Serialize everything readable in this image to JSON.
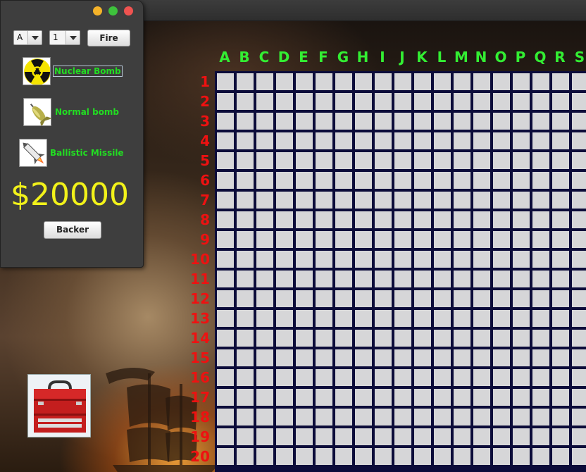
{
  "sidebar": {
    "column_select": {
      "value": "A"
    },
    "row_select": {
      "value": "1"
    },
    "fire_label": "Fire",
    "weapons": [
      {
        "label": "Nuclear Bomb",
        "icon": "radiation-icon"
      },
      {
        "label": "Normal bomb",
        "icon": "bomb-icon"
      },
      {
        "label": "Ballistic Missile",
        "icon": "missile-icon"
      }
    ],
    "money": "$20000",
    "backer_label": "Backer"
  },
  "grid": {
    "columns": [
      "A",
      "B",
      "C",
      "D",
      "E",
      "F",
      "G",
      "H",
      "I",
      "J",
      "K",
      "L",
      "M",
      "N",
      "O",
      "P",
      "Q",
      "R",
      "S"
    ],
    "rows": [
      "1",
      "2",
      "3",
      "4",
      "5",
      "6",
      "7",
      "8",
      "9",
      "10",
      "11",
      "12",
      "13",
      "14",
      "15",
      "16",
      "17",
      "18",
      "19",
      "20"
    ]
  },
  "colors": {
    "column_label": "#33ee33",
    "row_label": "#ee1111",
    "money": "#f2f21a",
    "weapon_label": "#22dd22",
    "cell": "#d6d6d8",
    "grid_line": "#0c0c3a"
  }
}
